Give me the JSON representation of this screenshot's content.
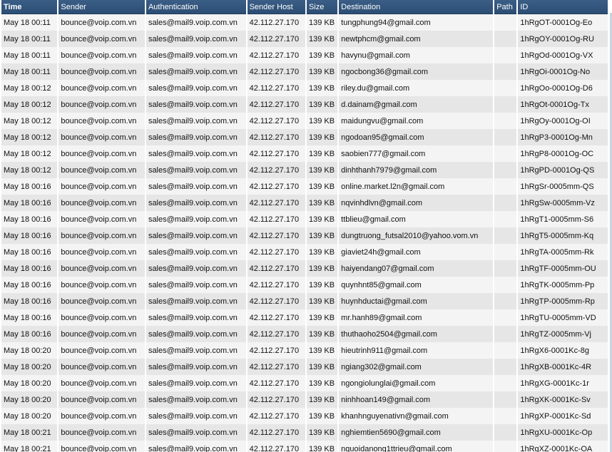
{
  "columns": [
    "Time",
    "Sender",
    "Authentication",
    "Sender Host",
    "Size",
    "Destination",
    "Path",
    "ID"
  ],
  "rows": [
    [
      "May 18 00:11",
      "bounce@voip.com.vn",
      "sales@mail9.voip.com.vn",
      "42.112.27.170",
      "139 KB",
      "tungphung94@gmail.com",
      "",
      "1hRgOT-0001Og-Eo"
    ],
    [
      "May 18 00:11",
      "bounce@voip.com.vn",
      "sales@mail9.voip.com.vn",
      "42.112.27.170",
      "139 KB",
      "newtphcm@gmail.com",
      "",
      "1hRgOY-0001Og-RU"
    ],
    [
      "May 18 00:11",
      "bounce@voip.com.vn",
      "sales@mail9.voip.com.vn",
      "42.112.27.170",
      "139 KB",
      "havynu@gmail.com",
      "",
      "1hRgOd-0001Og-VX"
    ],
    [
      "May 18 00:11",
      "bounce@voip.com.vn",
      "sales@mail9.voip.com.vn",
      "42.112.27.170",
      "139 KB",
      "ngocbong36@gmail.com",
      "",
      "1hRgOi-0001Og-No"
    ],
    [
      "May 18 00:12",
      "bounce@voip.com.vn",
      "sales@mail9.voip.com.vn",
      "42.112.27.170",
      "139 KB",
      "riley.du@gmail.com",
      "",
      "1hRgOo-0001Og-D6"
    ],
    [
      "May 18 00:12",
      "bounce@voip.com.vn",
      "sales@mail9.voip.com.vn",
      "42.112.27.170",
      "139 KB",
      "d.dainam@gmail.com",
      "",
      "1hRgOt-0001Og-Tx"
    ],
    [
      "May 18 00:12",
      "bounce@voip.com.vn",
      "sales@mail9.voip.com.vn",
      "42.112.27.170",
      "139 KB",
      "maidungvu@gmail.com",
      "",
      "1hRgOy-0001Og-OI"
    ],
    [
      "May 18 00:12",
      "bounce@voip.com.vn",
      "sales@mail9.voip.com.vn",
      "42.112.27.170",
      "139 KB",
      "ngodoan95@gmail.com",
      "",
      "1hRgP3-0001Og-Mn"
    ],
    [
      "May 18 00:12",
      "bounce@voip.com.vn",
      "sales@mail9.voip.com.vn",
      "42.112.27.170",
      "139 KB",
      "saobien777@gmail.com",
      "",
      "1hRgP8-0001Og-OC"
    ],
    [
      "May 18 00:12",
      "bounce@voip.com.vn",
      "sales@mail9.voip.com.vn",
      "42.112.27.170",
      "139 KB",
      "dinhthanh7979@gmail.com",
      "",
      "1hRgPD-0001Og-QS"
    ],
    [
      "May 18 00:16",
      "bounce@voip.com.vn",
      "sales@mail9.voip.com.vn",
      "42.112.27.170",
      "139 KB",
      "online.market.l2n@gmail.com",
      "",
      "1hRgSr-0005mm-QS"
    ],
    [
      "May 18 00:16",
      "bounce@voip.com.vn",
      "sales@mail9.voip.com.vn",
      "42.112.27.170",
      "139 KB",
      "nqvinhdlvn@gmail.com",
      "",
      "1hRgSw-0005mm-Vz"
    ],
    [
      "May 18 00:16",
      "bounce@voip.com.vn",
      "sales@mail9.voip.com.vn",
      "42.112.27.170",
      "139 KB",
      "ttblieu@gmail.com",
      "",
      "1hRgT1-0005mm-S6"
    ],
    [
      "May 18 00:16",
      "bounce@voip.com.vn",
      "sales@mail9.voip.com.vn",
      "42.112.27.170",
      "139 KB",
      "dungtruong_futsal2010@yahoo.vom.vn",
      "",
      "1hRgT5-0005mm-Kq"
    ],
    [
      "May 18 00:16",
      "bounce@voip.com.vn",
      "sales@mail9.voip.com.vn",
      "42.112.27.170",
      "139 KB",
      "giaviet24h@gmail.com",
      "",
      "1hRgTA-0005mm-Rk"
    ],
    [
      "May 18 00:16",
      "bounce@voip.com.vn",
      "sales@mail9.voip.com.vn",
      "42.112.27.170",
      "139 KB",
      "haiyendang07@gmail.com",
      "",
      "1hRgTF-0005mm-OU"
    ],
    [
      "May 18 00:16",
      "bounce@voip.com.vn",
      "sales@mail9.voip.com.vn",
      "42.112.27.170",
      "139 KB",
      "quynhnt85@gmail.com",
      "",
      "1hRgTK-0005mm-Pp"
    ],
    [
      "May 18 00:16",
      "bounce@voip.com.vn",
      "sales@mail9.voip.com.vn",
      "42.112.27.170",
      "139 KB",
      "huynhductai@gmail.com",
      "",
      "1hRgTP-0005mm-Rp"
    ],
    [
      "May 18 00:16",
      "bounce@voip.com.vn",
      "sales@mail9.voip.com.vn",
      "42.112.27.170",
      "139 KB",
      "mr.hanh89@gmail.com",
      "",
      "1hRgTU-0005mm-VD"
    ],
    [
      "May 18 00:16",
      "bounce@voip.com.vn",
      "sales@mail9.voip.com.vn",
      "42.112.27.170",
      "139 KB",
      "thuthaoho2504@gmail.com",
      "",
      "1hRgTZ-0005mm-Vj"
    ],
    [
      "May 18 00:20",
      "bounce@voip.com.vn",
      "sales@mail9.voip.com.vn",
      "42.112.27.170",
      "139 KB",
      "hieutrinh911@gmail.com",
      "",
      "1hRgX6-0001Kc-8g"
    ],
    [
      "May 18 00:20",
      "bounce@voip.com.vn",
      "sales@mail9.voip.com.vn",
      "42.112.27.170",
      "139 KB",
      "ngiang302@gmail.com",
      "",
      "1hRgXB-0001Kc-4R"
    ],
    [
      "May 18 00:20",
      "bounce@voip.com.vn",
      "sales@mail9.voip.com.vn",
      "42.112.27.170",
      "139 KB",
      "ngongiolunglai@gmail.com",
      "",
      "1hRgXG-0001Kc-1r"
    ],
    [
      "May 18 00:20",
      "bounce@voip.com.vn",
      "sales@mail9.voip.com.vn",
      "42.112.27.170",
      "139 KB",
      "ninhhoan149@gmail.com",
      "",
      "1hRgXK-0001Kc-Sv"
    ],
    [
      "May 18 00:20",
      "bounce@voip.com.vn",
      "sales@mail9.voip.com.vn",
      "42.112.27.170",
      "139 KB",
      "khanhnguyenativn@gmail.com",
      "",
      "1hRgXP-0001Kc-Sd"
    ],
    [
      "May 18 00:21",
      "bounce@voip.com.vn",
      "sales@mail9.voip.com.vn",
      "42.112.27.170",
      "139 KB",
      "nghiemtien5690@gmail.com",
      "",
      "1hRgXU-0001Kc-Op"
    ],
    [
      "May 18 00:21",
      "bounce@voip.com.vn",
      "sales@mail9.voip.com.vn",
      "42.112.27.170",
      "139 KB",
      "nguoidanong1ttrieu@gmail.com",
      "",
      "1hRgXZ-0001Kc-OA"
    ]
  ],
  "colors": {
    "header_bg": "#2f5179",
    "row_odd": "#f4f4f4",
    "row_even": "#e6e6e6",
    "text": "#111111"
  }
}
